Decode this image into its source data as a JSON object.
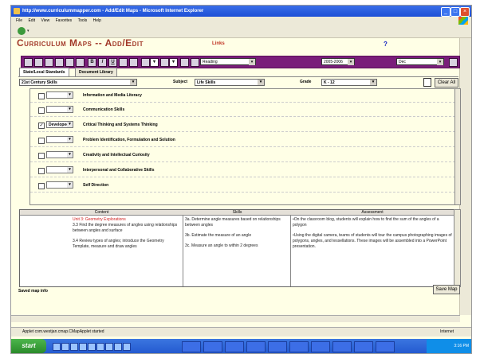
{
  "window": {
    "title": "http://www.curriculummapper.com - Add/Edit Maps - Microsoft Internet Explorer",
    "menu": [
      "File",
      "Edit",
      "View",
      "Favorites",
      "Tools",
      "Help"
    ]
  },
  "page": {
    "title": "Curriculum Maps -- Add/Edit",
    "links_label": "Links",
    "help_label": "?"
  },
  "toolbar": {
    "subject_select": "Reading",
    "year_select": "2005-2006",
    "month_select": "Dec"
  },
  "tabs": [
    {
      "label": "State/Local Standards",
      "active": true
    },
    {
      "label": "Document Library",
      "active": false
    }
  ],
  "filters": {
    "standards_set": "21st Century Skills",
    "subject_label": "Subject",
    "subject_value": "Life Skills",
    "grade_label": "Grade",
    "grade_value": "K - 12",
    "clear_all": "Clear All"
  },
  "standards": [
    {
      "checked": false,
      "level": "",
      "name": "Information and Media Literacy"
    },
    {
      "checked": false,
      "level": "",
      "name": "Communication Skills"
    },
    {
      "checked": true,
      "level": "Developed",
      "name": "Critical Thinking and Systems Thinking"
    },
    {
      "checked": false,
      "level": "",
      "name": "Problem Identification, Formulation and Solution"
    },
    {
      "checked": false,
      "level": "",
      "name": "Creativity and Intellectual Curiosity"
    },
    {
      "checked": false,
      "level": "",
      "name": "Interpersonal and Collaborative Skills"
    },
    {
      "checked": false,
      "level": "",
      "name": "Self Direction"
    }
  ],
  "map": {
    "headers": {
      "content": "Content",
      "skills": "Skills",
      "assessment": "Assessment"
    },
    "content": {
      "unit": "Unit 3: Geometry Explorations",
      "items": [
        "3.3 Find the degree measures of angles using relationships between angles and surface",
        "3.4 Review types of angles; introduce the Geometry Template, measure and draw angles"
      ]
    },
    "skills": [
      "3a. Determine angle measures based on relationships between angles",
      "3b. Estimate the measure of an angle",
      "3c. Measure an angle to within 2 degrees"
    ],
    "assessment": [
      "•On the classroom blog, students will explain how to find the sum of the angles of a polygon",
      "•Using the digital camera, teams of students will tour the campus photographing images of polygons, angles, and tessellations. These images will be assembled into a PowerPoint presentation."
    ]
  },
  "saved_info": "Saved map info",
  "save_button": "Save Map",
  "status": {
    "text": "Applet com.westjan.cmap.CMapApplet started",
    "zone": "Internet"
  },
  "taskbar": {
    "start": "start",
    "clock": "3:16 PM"
  }
}
